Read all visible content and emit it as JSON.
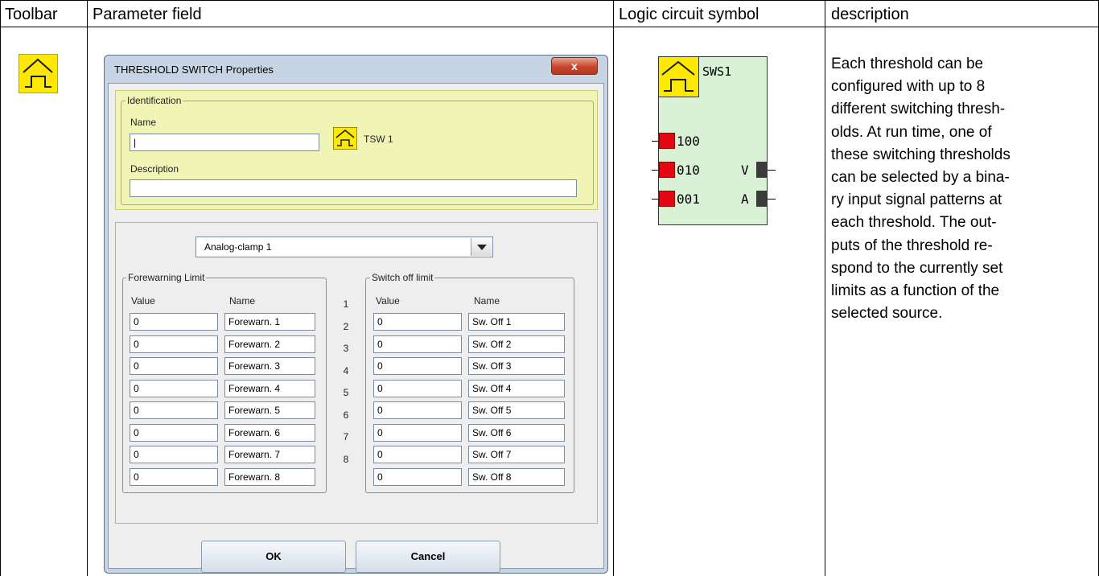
{
  "table": {
    "headers": [
      "Toolbar",
      "Parameter field",
      "Logic circuit symbol",
      "description"
    ]
  },
  "dialog": {
    "title": "THRESHOLD SWITCH Properties",
    "close_label": "x",
    "identification": {
      "legend": "Identification",
      "name_label": "Name",
      "name_value": "|",
      "block_label": "TSW 1",
      "description_label": "Description",
      "description_value": ""
    },
    "source_select": "Analog-clamp  1",
    "forewarning": {
      "legend": "Forewarning Limit",
      "value_header": "Value",
      "name_header": "Name",
      "rows": [
        {
          "value": "0",
          "name": "Forewarn. 1"
        },
        {
          "value": "0",
          "name": "Forewarn. 2"
        },
        {
          "value": "0",
          "name": "Forewarn. 3"
        },
        {
          "value": "0",
          "name": "Forewarn. 4"
        },
        {
          "value": "0",
          "name": "Forewarn. 5"
        },
        {
          "value": "0",
          "name": "Forewarn. 6"
        },
        {
          "value": "0",
          "name": "Forewarn. 7"
        },
        {
          "value": "0",
          "name": "Forewarn. 8"
        }
      ]
    },
    "row_numbers": [
      "1",
      "2",
      "3",
      "4",
      "5",
      "6",
      "7",
      "8"
    ],
    "switch_off": {
      "legend": "Switch off limit",
      "value_header": "Value",
      "name_header": "Name",
      "rows": [
        {
          "value": "0",
          "name": "Sw. Off 1"
        },
        {
          "value": "0",
          "name": "Sw. Off 2"
        },
        {
          "value": "0",
          "name": "Sw. Off 3"
        },
        {
          "value": "0",
          "name": "Sw. Off 4"
        },
        {
          "value": "0",
          "name": "Sw. Off 5"
        },
        {
          "value": "0",
          "name": "Sw. Off 6"
        },
        {
          "value": "0",
          "name": "Sw. Off 7"
        },
        {
          "value": "0",
          "name": "Sw. Off 8"
        }
      ]
    },
    "ok_label": "OK",
    "cancel_label": "Cancel"
  },
  "symbol": {
    "name": "SWS1",
    "inputs": [
      "100",
      "010",
      "001"
    ],
    "outputs": [
      "V",
      "A"
    ],
    "colors": {
      "body": "#d9f2d6",
      "icon": "#fde800",
      "input_pin": "#e30613",
      "output_pin": "#3b3b3b"
    }
  },
  "description": {
    "lines": [
      "Each threshold can be",
      "configured with up to 8",
      "different switching thresh-",
      "olds. At run time, one of",
      "these switching thresholds",
      "can be selected by a bina-",
      "ry input signal patterns at",
      "each threshold. The out-",
      "puts of the threshold re-",
      "spond to the currently set",
      "limits as a function of the",
      "selected source."
    ]
  },
  "icons": {
    "toolbar": "threshold-switch-icon",
    "identification": "threshold-switch-icon",
    "symbol": "threshold-switch-icon",
    "combo": "chevron-down-icon"
  }
}
